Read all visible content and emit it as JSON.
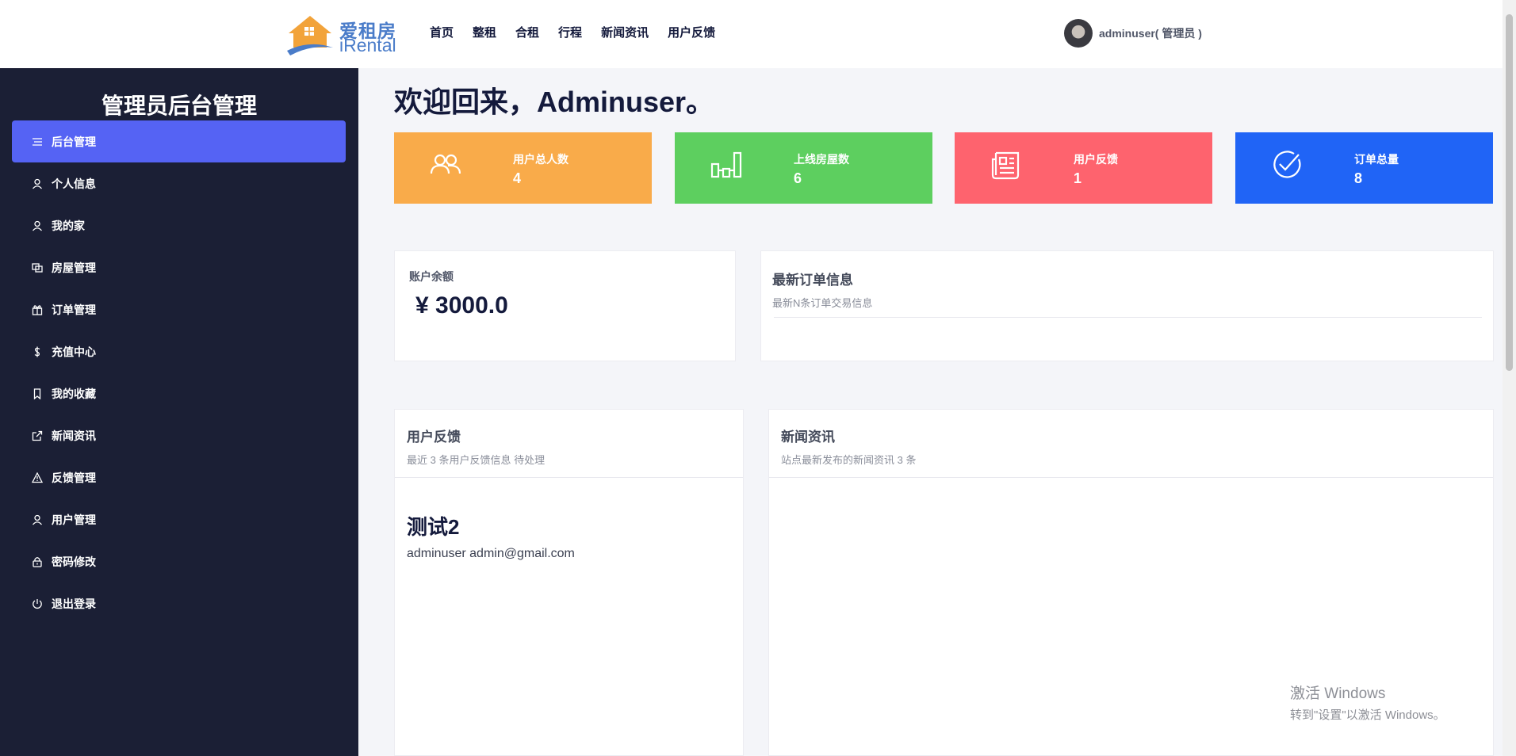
{
  "brand": {
    "cn": "爱租房",
    "en": "iRental"
  },
  "nav": [
    {
      "label": "首页"
    },
    {
      "label": "整租"
    },
    {
      "label": "合租"
    },
    {
      "label": "行程"
    },
    {
      "label": "新闻资讯"
    },
    {
      "label": "用户反馈"
    }
  ],
  "user": {
    "name": "adminuser( 管理员 )"
  },
  "sidebar": {
    "title": "管理员后台管理",
    "items": [
      {
        "label": "后台管理",
        "icon": "list-icon",
        "active": true
      },
      {
        "label": "个人信息",
        "icon": "user-icon"
      },
      {
        "label": "我的家",
        "icon": "user-icon"
      },
      {
        "label": "房屋管理",
        "icon": "copy-icon"
      },
      {
        "label": "订单管理",
        "icon": "gift-icon"
      },
      {
        "label": "充值中心",
        "icon": "dollar-icon"
      },
      {
        "label": "我的收藏",
        "icon": "bookmark-icon"
      },
      {
        "label": "新闻资讯",
        "icon": "external-link-icon"
      },
      {
        "label": "反馈管理",
        "icon": "warning-icon"
      },
      {
        "label": "用户管理",
        "icon": "user-icon"
      },
      {
        "label": "密码修改",
        "icon": "lock-icon"
      },
      {
        "label": "退出登录",
        "icon": "power-icon"
      }
    ]
  },
  "welcome": "欢迎回来，Adminuser。",
  "stats": [
    {
      "label": "用户总人数",
      "value": "4",
      "icon": "users-icon",
      "color": "#f9ab4a"
    },
    {
      "label": "上线房屋数",
      "value": "6",
      "icon": "bar-chart-icon",
      "color": "#5dcf5f"
    },
    {
      "label": "用户反馈",
      "value": "1",
      "icon": "newspaper-icon",
      "color": "#fe636e"
    },
    {
      "label": "订单总量",
      "value": "8",
      "icon": "check-circle-icon",
      "color": "#2064f6"
    }
  ],
  "balance": {
    "label": "账户余额",
    "value": "¥ 3000.0"
  },
  "orders": {
    "title": "最新订单信息",
    "subtitle": "最新N条订单交易信息"
  },
  "feedback": {
    "title": "用户反馈",
    "subtitle": "最近 3 条用户反馈信息 待处理",
    "entry_title": "测试2",
    "entry_meta": "adminuser admin@gmail.com"
  },
  "news": {
    "title": "新闻资讯",
    "subtitle": "站点最新发布的新闻资讯 3 条"
  },
  "watermark": {
    "line1": "激活 Windows",
    "line2": "转到\"设置\"以激活 Windows。"
  }
}
